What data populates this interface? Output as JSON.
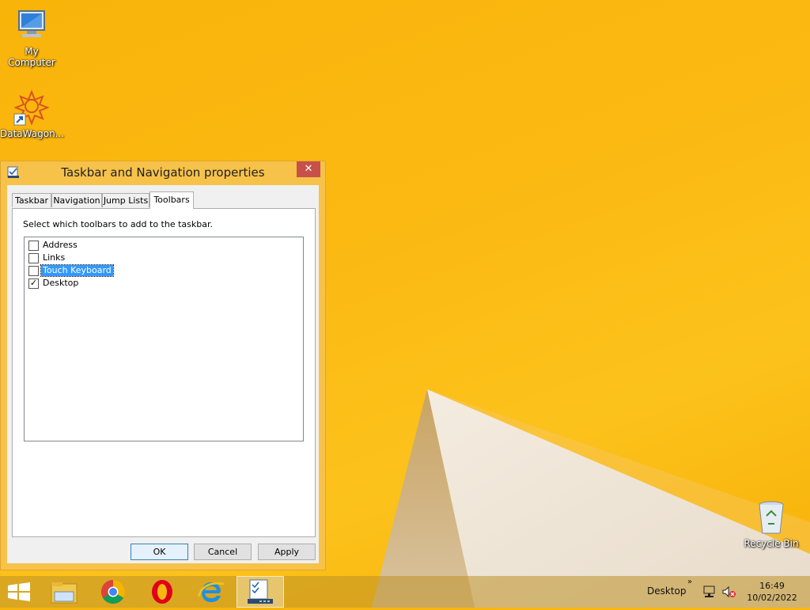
{
  "desktop": {
    "icons": [
      {
        "label": "My Computer",
        "icon": "computer-icon"
      },
      {
        "label": "DataWagon...",
        "icon": "datawagon-icon"
      },
      {
        "label": "Recycle Bin",
        "icon": "recycle-bin-icon"
      }
    ]
  },
  "dialog": {
    "title": "Taskbar and Navigation properties",
    "close_label": "✕",
    "tabs": [
      {
        "label": "Taskbar",
        "active": false
      },
      {
        "label": "Navigation",
        "active": false
      },
      {
        "label": "Jump Lists",
        "active": false
      },
      {
        "label": "Toolbars",
        "active": true
      }
    ],
    "instruction": "Select which toolbars to add to the taskbar.",
    "toolbars": [
      {
        "label": "Address",
        "checked": false,
        "selected": false
      },
      {
        "label": "Links",
        "checked": false,
        "selected": false
      },
      {
        "label": "Touch Keyboard",
        "checked": false,
        "selected": true
      },
      {
        "label": "Desktop",
        "checked": true,
        "selected": false
      }
    ],
    "buttons": {
      "ok": "OK",
      "cancel": "Cancel",
      "apply": "Apply"
    }
  },
  "taskbar": {
    "start_icon": "windows-start-icon",
    "pinned": [
      {
        "icon": "file-explorer-icon"
      },
      {
        "icon": "chrome-icon"
      },
      {
        "icon": "opera-icon"
      },
      {
        "icon": "internet-explorer-icon"
      },
      {
        "icon": "taskbar-properties-icon",
        "active": true
      }
    ],
    "toolbar_label": "Desktop",
    "chevron": "»",
    "clock_time": "16:49",
    "clock_date": "10/02/2022"
  },
  "colors": {
    "wallpaper": "#fbb912",
    "dialog_frame": "#f6c24a",
    "close_button": "#c7504a",
    "selection": "#3399ff"
  }
}
